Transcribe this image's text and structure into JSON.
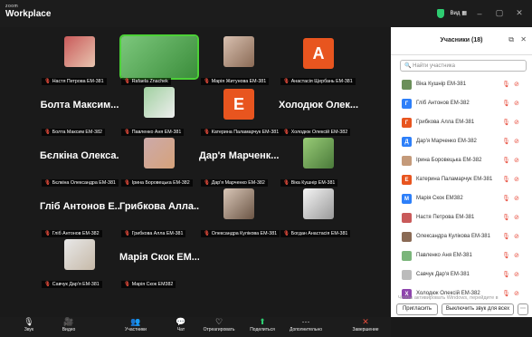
{
  "app": {
    "brand_small": "zoom",
    "brand": "Workplace",
    "view_label": "Вид"
  },
  "tiles": [
    {
      "name": "Настя Петрова ЕМ-381",
      "kind": "photo",
      "cls": "photo1"
    },
    {
      "name": "Rafaela Znachek",
      "kind": "photo",
      "cls": "photo2",
      "speaking": true
    },
    {
      "name": "Марія Житунова ЕМ-381",
      "kind": "photo",
      "cls": "photo3"
    },
    {
      "name": "Анастасія Щербань ЕМ-381",
      "kind": "letter",
      "letter": "A"
    },
    {
      "name": "Болта Максим ЕМ-382",
      "kind": "name",
      "big": "Болта Максим..."
    },
    {
      "name": "Павленко Аня ЕМ-381",
      "kind": "photo",
      "cls": "photo4"
    },
    {
      "name": "Катерина Паламарчук ЕМ-381",
      "kind": "letter",
      "letter": "E"
    },
    {
      "name": "Холодюк Олексій ЕМ-382",
      "kind": "name",
      "big": "Холодюк Олек..."
    },
    {
      "name": "Бєлкіна Олександра ЕМ-381",
      "kind": "name",
      "big": "Бєлкіна Олекса..."
    },
    {
      "name": "Ірина Боровецька ЕМ-382",
      "kind": "photo",
      "cls": "photo5"
    },
    {
      "name": "Дар'я Марченко ЕМ-382",
      "kind": "name",
      "big": "Дар'я Марченк..."
    },
    {
      "name": "Віка Кушнір ЕМ-381",
      "kind": "photo",
      "cls": "photo6"
    },
    {
      "name": "Гліб Антонов ЕМ-382",
      "kind": "name",
      "big": "Гліб Антонов Е..."
    },
    {
      "name": "Грибкова Алла ЕМ-381",
      "kind": "name",
      "big": "Грибкова Алла..."
    },
    {
      "name": "Олександра Кулікова ЕМ-381",
      "kind": "photo",
      "cls": "photo7"
    },
    {
      "name": "Богдан Анастасія ЕМ-381",
      "kind": "photo",
      "cls": "photo8"
    },
    {
      "name": "Савчук Дар'я ЕМ-381",
      "kind": "photo",
      "cls": "photo9"
    },
    {
      "name": "Марія Скок ЕМ382",
      "kind": "name",
      "big": "Марія Скок ЕМ..."
    }
  ],
  "panel": {
    "title": "Учасники (18)",
    "search_placeholder": "Найти участника",
    "participants": [
      {
        "name": "Віка Кушнір ЕМ-381",
        "color": "#6b8f5a",
        "letter": ""
      },
      {
        "name": "Гліб Антонов ЕМ-382",
        "color": "#2d7ff9",
        "letter": "Г"
      },
      {
        "name": "Грибкова Алла ЕМ-381",
        "color": "#e8551f",
        "letter": "Г"
      },
      {
        "name": "Дар'я Марченко ЕМ-382",
        "color": "#2d7ff9",
        "letter": "Д"
      },
      {
        "name": "Ірина Боровецька ЕМ-382",
        "color": "#c49a7a",
        "letter": ""
      },
      {
        "name": "Катерина Паламарчук ЕМ-381",
        "color": "#e8551f",
        "letter": "E"
      },
      {
        "name": "Марія Скок ЕМ382",
        "color": "#2d7ff9",
        "letter": "M"
      },
      {
        "name": "Настя Петрова ЕМ-381",
        "color": "#c95a5a",
        "letter": ""
      },
      {
        "name": "Олександра Кулікова ЕМ-381",
        "color": "#8a6a55",
        "letter": ""
      },
      {
        "name": "Павленко Аня ЕМ-381",
        "color": "#7ab57a",
        "letter": ""
      },
      {
        "name": "Савчук Дар'я ЕМ-381",
        "color": "#bbb",
        "letter": ""
      },
      {
        "name": "Холодюк Олексій ЕМ-382",
        "color": "#8e44ad",
        "letter": "X"
      }
    ],
    "watermark": "Чтобы активировать Windows, перейдите в",
    "invite": "Пригласить",
    "mute_all": "Выключить звук для всех"
  },
  "toolbar": [
    {
      "label": "Звук",
      "icon": "🎙"
    },
    {
      "label": "Видео",
      "icon": "🎥"
    },
    {
      "label": "Участники",
      "icon": "👥"
    },
    {
      "label": "Чат",
      "icon": "💬"
    },
    {
      "label": "Отреагировать",
      "icon": "♡"
    },
    {
      "label": "Поделиться",
      "icon": "⬆"
    },
    {
      "label": "Дополнительно",
      "icon": "⋯"
    },
    {
      "label": "Завершение",
      "icon": "✕"
    }
  ],
  "participant_count": "18"
}
